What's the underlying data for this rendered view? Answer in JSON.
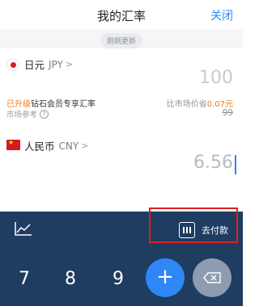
{
  "header": {
    "title": "我的汇率",
    "close_label": "关闭"
  },
  "refresh": {
    "label": "刚刚更新"
  },
  "jpy": {
    "name": "日元",
    "code": "JPY",
    "amount": "100",
    "promo_upgrade": "已升级",
    "promo_rate": "钻石会员专享汇率",
    "market_ref": "市场参考",
    "cheaper_prefix": "比市场价省",
    "cheaper_amount": "0.07元",
    "market_value": "99"
  },
  "cny": {
    "name": "人民币",
    "code": "CNY",
    "amount": "6.56"
  },
  "keyboard": {
    "pay_label": "去付款",
    "keys": {
      "k7": "7",
      "k8": "8",
      "k9": "9",
      "plus": "+"
    }
  },
  "icons": {
    "trend": "trend-chart-icon",
    "pay": "barcode-icon",
    "delete": "backspace-icon"
  },
  "colors": {
    "accent": "#2f86f6",
    "orange": "#f07a1a",
    "keyboard_bg": "#1f3c61",
    "highlight": "#e11f1f"
  }
}
